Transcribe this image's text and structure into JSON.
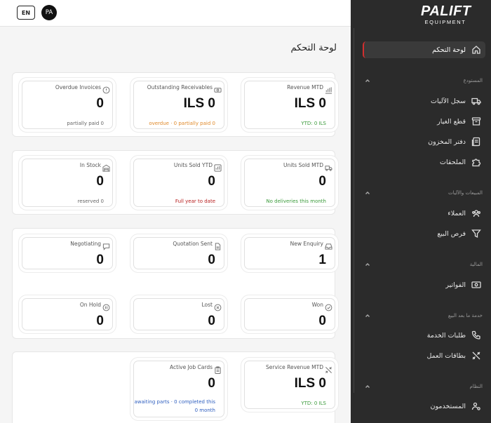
{
  "topbar": {
    "lang_label": "EN",
    "avatar_initials": "PA"
  },
  "brand": {
    "logo_line1": "PALIFT",
    "logo_line2": "EQUIPMENT"
  },
  "page": {
    "title": "لوحة التحكم"
  },
  "sidebar": {
    "dashboard": "لوحة التحكم",
    "sections": {
      "warehouse": "المستودع",
      "sales": "المبيعات والآليات",
      "finance": "المالية",
      "after_sales": "خدمة ما بعد البيع",
      "system": "النظام"
    },
    "items": {
      "machines": "سجل الآليات",
      "parts": "قطع الغيار",
      "inventory": "دفتر المخزون",
      "attachments": "الملحقات",
      "customers": "العملاء",
      "opportunities": "فرص البيع",
      "invoices": "الفواتير",
      "service_requests": "طلبات الخدمة",
      "job_cards": "بطاقات العمل",
      "users": "المستخدمون"
    }
  },
  "cards": {
    "revenue_mtd": {
      "title": "Revenue MTD",
      "value": "ILS 0",
      "sub": "YTD: 0 ILS"
    },
    "outstanding": {
      "title": "Outstanding Receivables",
      "value": "ILS 0",
      "sub": "overdue · 0 partially paid 0"
    },
    "overdue": {
      "title": "Overdue Invoices",
      "value": "0",
      "sub": "partially paid 0"
    },
    "units_sold_mtd": {
      "title": "Units Sold MTD",
      "value": "0",
      "sub": "No deliveries this month"
    },
    "units_sold_ytd": {
      "title": "Units Sold YTD",
      "value": "0",
      "sub": "Full year to date"
    },
    "in_stock": {
      "title": "In Stock",
      "value": "0",
      "sub": "reserved 0"
    },
    "new_enquiry": {
      "title": "New Enquiry",
      "value": "1"
    },
    "quotation_sent": {
      "title": "Quotation Sent",
      "value": "0"
    },
    "negotiating": {
      "title": "Negotiating",
      "value": "0"
    },
    "won": {
      "title": "Won",
      "value": "0"
    },
    "lost": {
      "title": "Lost",
      "value": "0"
    },
    "on_hold": {
      "title": "On Hold",
      "value": "0"
    },
    "service_revenue": {
      "title": "Service Revenue MTD",
      "value": "ILS 0",
      "sub": "YTD: 0 ILS"
    },
    "active_job_cards": {
      "title": "Active Job Cards",
      "value": "0",
      "sub": "awaiting parts · 0 completed this 0 month"
    }
  },
  "colors": {
    "sidebar_bg": "#2b2b2b",
    "active_accent": "#d32f2f",
    "green": "#3a9a3a",
    "orange": "#e08a2b",
    "red": "#b71c1c",
    "blue": "#2f5fbf"
  }
}
